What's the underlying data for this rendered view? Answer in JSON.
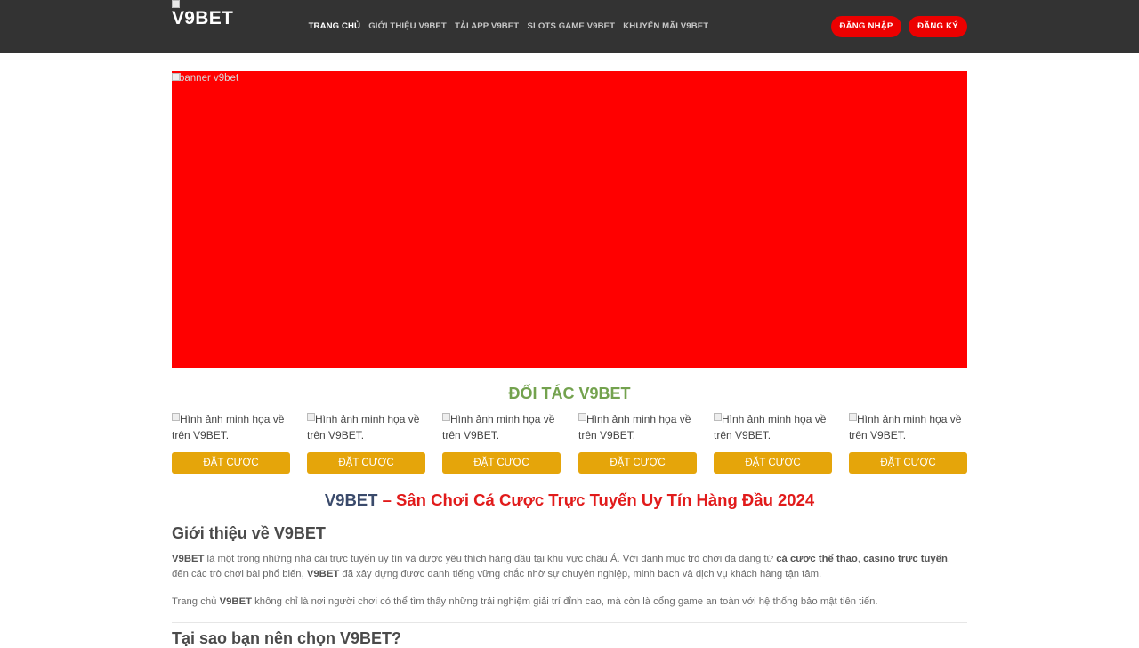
{
  "header": {
    "logo_text": "V9BET",
    "nav": [
      {
        "label": "TRANG CHỦ"
      },
      {
        "label": "GIỚI THIỆU V9BET"
      },
      {
        "label": "TẢI APP V9BET"
      },
      {
        "label": "SLOTS GAME V9BET"
      },
      {
        "label": "KHUYẾN MÃI V9BET"
      }
    ],
    "login_label": "ĐĂNG NHẬP",
    "register_label": "ĐĂNG KÝ"
  },
  "banner": {
    "alt_text": "banner v9bet",
    "color": "#ff0000"
  },
  "partners": {
    "title": "ĐỐI TÁC V9BET",
    "items": [
      {
        "alt": "Hình ảnh minh họa về trên V9BET.",
        "button": "ĐẶT CƯỢC"
      },
      {
        "alt": "Hình ảnh minh họa về trên V9BET.",
        "button": "ĐẶT CƯỢC"
      },
      {
        "alt": "Hình ảnh minh họa về trên V9BET.",
        "button": "ĐẶT CƯỢC"
      },
      {
        "alt": "Hình ảnh minh họa về trên V9BET.",
        "button": "ĐẶT CƯỢC"
      },
      {
        "alt": "Hình ảnh minh họa về trên V9BET.",
        "button": "ĐẶT CƯỢC"
      },
      {
        "alt": "Hình ảnh minh họa về trên V9BET.",
        "button": "ĐẶT CƯỢC"
      }
    ]
  },
  "article": {
    "title_brand": "V9BET",
    "title_rest": " – Sân Chơi Cá Cược Trực Tuyến Uy Tín Hàng Đầu 2024",
    "intro_heading": "Giới thiệu về V9BET",
    "p1": {
      "b1": "V9BET",
      "t1": " là một trong những nhà cái trực tuyến uy tín và được yêu thích hàng đầu tại khu vực châu Á. Với danh mục trò chơi đa dạng từ ",
      "b2": "cá cược thể thao",
      "t2": ", ",
      "b3": "casino trực tuyến",
      "t3": ", đến các trò chơi bài phổ biến, ",
      "b4": "V9BET",
      "t4": " đã xây dựng được danh tiếng vững chắc nhờ sự chuyên nghiệp, minh bạch và dịch vụ khách hàng tận tâm."
    },
    "p2": {
      "t1": "Trang chủ ",
      "b1": "V9BET",
      "t2": " không chỉ là nơi người chơi có thể tìm thấy những trải nghiệm giải trí đỉnh cao, mà còn là cổng game an toàn với hệ thống bảo mật tiên tiến."
    },
    "why_heading": "Tại sao bạn nên chọn V9BET?"
  },
  "colors": {
    "header_bg": "#333333",
    "accent_red": "#ec0000",
    "bet_button": "#e5a50a",
    "partners_title": "#73a24e"
  }
}
